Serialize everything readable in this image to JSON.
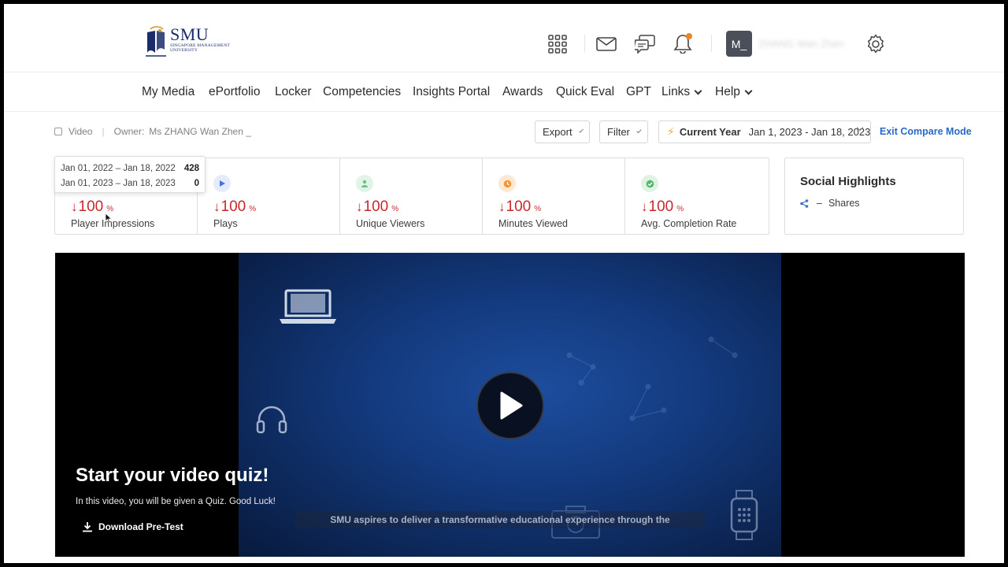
{
  "brand": {
    "name": "SMU",
    "subtitle_line1": "SINGAPORE MANAGEMENT",
    "subtitle_line2": "UNIVERSITY",
    "color": "#1a2c6b"
  },
  "header": {
    "icons": [
      "apps-grid-icon",
      "mail-icon",
      "chat-icon",
      "bell-icon",
      "settings-icon"
    ],
    "avatar_initials": "M_",
    "user_name": "ZHANG Wan Zhen",
    "notification_color": "#f0832a"
  },
  "nav": {
    "items": [
      {
        "label": "My Media"
      },
      {
        "label": "ePortfolio"
      },
      {
        "label": "Locker"
      },
      {
        "label": "Competencies"
      },
      {
        "label": "Insights Portal"
      },
      {
        "label": "Awards"
      },
      {
        "label": "Quick Eval"
      },
      {
        "label": "GPT"
      },
      {
        "label": "Links"
      },
      {
        "label": "Help"
      }
    ]
  },
  "toolbar": {
    "type_label": "Video",
    "owner_label": "Owner:",
    "owner_name": "Ms ZHANG Wan Zhen _",
    "export_label": "Export",
    "filter_label": "Filter",
    "period_label": "Current Year",
    "period_range": "Jan 1, 2023 - Jan 18, 2023",
    "exit_compare_label": "Exit Compare Mode",
    "link_color": "#2a6ac6"
  },
  "compare_tooltip": {
    "rows": [
      {
        "range": "Jan 01, 2022 – Jan 18, 2022",
        "value": "428"
      },
      {
        "range": "Jan 01, 2023 – Jan 18, 2023",
        "value": "0"
      }
    ]
  },
  "stats": [
    {
      "label": "Player Impressions",
      "arrow": "↓",
      "value": "100",
      "unit": "%",
      "icon": "eye-icon",
      "icon_color": "#9aa7c8"
    },
    {
      "label": "Plays",
      "arrow": "↓",
      "value": "100",
      "unit": "%",
      "icon": "play-icon",
      "icon_color": "#4a72d9"
    },
    {
      "label": "Unique Viewers",
      "arrow": "↓",
      "value": "100",
      "unit": "%",
      "icon": "user-icon",
      "icon_color": "#6cc18a"
    },
    {
      "label": "Minutes Viewed",
      "arrow": "↓",
      "value": "100",
      "unit": "%",
      "icon": "clock-icon",
      "icon_color": "#f0983a"
    },
    {
      "label": "Avg. Completion Rate",
      "arrow": "↓",
      "value": "100",
      "unit": "%",
      "icon": "check-icon",
      "icon_color": "#52b96a"
    }
  ],
  "decline_color": "#c8282d",
  "social": {
    "title": "Social Highlights",
    "dash": "–",
    "shares_label": "Shares"
  },
  "player": {
    "quiz_title": "Start your video quiz!",
    "quiz_desc": "In this video, you will be given a Quiz. Good Luck!",
    "download_label": "Download Pre-Test",
    "caption": "SMU aspires to deliver a transformative educational experience through the"
  }
}
